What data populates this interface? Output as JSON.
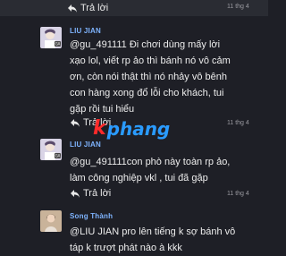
{
  "comments": [
    {
      "reply_label": "Trả lời",
      "time": "11 thg 4"
    },
    {
      "author": "LIU JIAN",
      "avatar_badge": "GA",
      "text_lines": [
        "@gu_491111 Đi chơi dùng mấy lời",
        "xạo lol, viết rp ảo thì bánh nó vô cảm",
        "ơn, còn nói thật thì nó nhảy vô bênh",
        "con hàng xong đổ lỗi cho khách, tui",
        "gặp rồi tui hiểu"
      ],
      "reply_label": "Trả lời",
      "time": "11 thg 4"
    },
    {
      "author": "LIU JIAN",
      "avatar_badge": "GA",
      "text_lines": [
        "@gu_491111con phò này toàn rp ảo,",
        "làm công nghiệp vkl , tui đã gặp"
      ],
      "reply_label": "Trả lời",
      "time": "11 thg 4"
    },
    {
      "author": "Song Thành",
      "text_lines": [
        "@LIU JIAN pro lên tiếng k sợ bánh vô",
        "táp k trượt phát nào à kkk"
      ]
    }
  ],
  "watermark": {
    "first": "k",
    "rest": "phang"
  },
  "icons": {
    "reply": "reply-arrow-icon"
  },
  "colors": {
    "background": "#1e1f26",
    "author": "#7fb4ff",
    "watermark_red": "#ff2a2a",
    "watermark_blue": "#2a9bff"
  }
}
